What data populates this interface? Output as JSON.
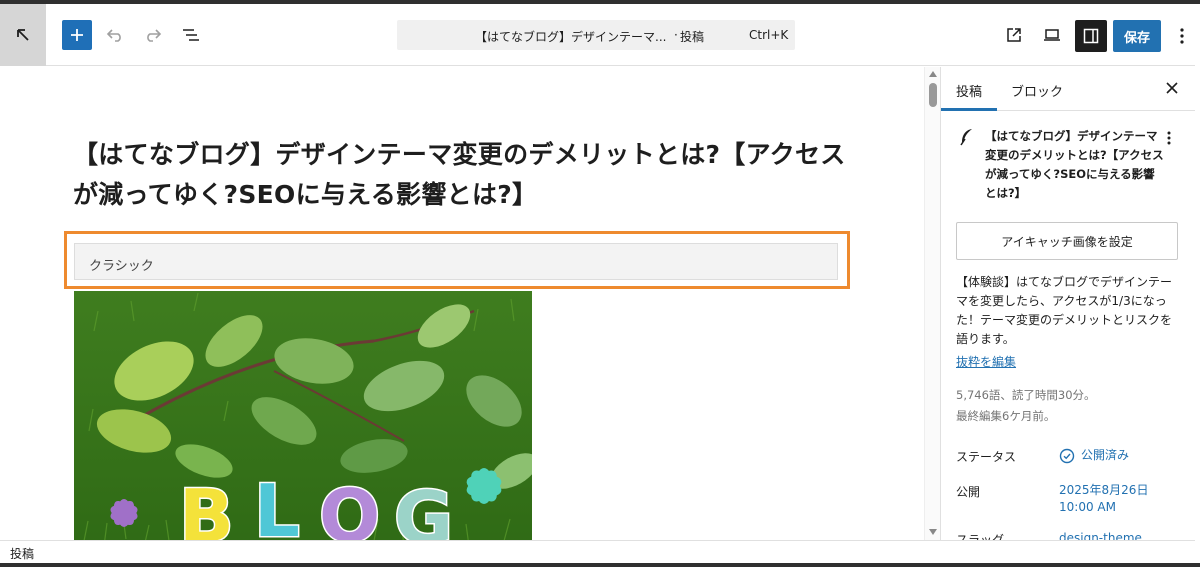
{
  "toolbar": {
    "command_title": "【はてなブログ】デザインテーマ...",
    "command_separator": "·",
    "command_type": "投稿",
    "command_shortcut": "Ctrl+K",
    "save_label": "保存"
  },
  "editor": {
    "title": "【はてなブログ】デザインテーマ変更のデメリットとは?【アクセスが減ってゆく?SEOに与える影響とは?】",
    "classic_block_label": "クラシック",
    "image_letters": [
      "B",
      "L",
      "O",
      "G"
    ]
  },
  "sidebar": {
    "tabs": [
      {
        "label": "投稿",
        "active": true
      },
      {
        "label": "ブロック",
        "active": false
      }
    ],
    "post_title": "【はてなブログ】デザインテーマ変更のデメリットとは?【アクセスが減ってゆく?SEOに与える影響とは?】",
    "featured_image_button": "アイキャッチ画像を設定",
    "excerpt": "【体験談】はてなブログでデザインテーマを変更したら、アクセスが1/3になった！テーマ変更のデメリットとリスクを語ります。",
    "excerpt_edit_link": "抜粋を編集",
    "word_count": "5,746語、読了時間30分。",
    "last_edited": "最終編集6ケ月前。",
    "status_label": "ステータス",
    "status_value": "公開済み",
    "publish_label": "公開",
    "publish_date": "2025年8月26日",
    "publish_time": "10:00 AM",
    "slug_label": "スラッグ",
    "slug_value": "design-theme"
  },
  "footer": {
    "breadcrumb": "投稿"
  },
  "colors": {
    "primary": "#2271b1",
    "highlight": "#ee8a2f",
    "dark": "#1e1e1e"
  }
}
